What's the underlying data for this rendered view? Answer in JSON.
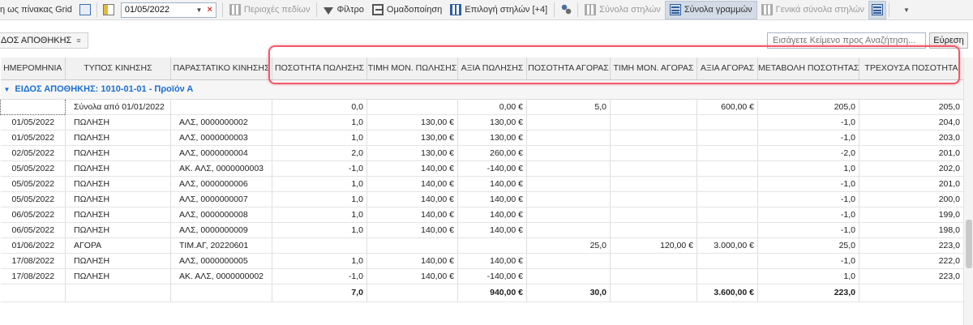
{
  "toolbar": {
    "grid_label": "η ως πίνακας Grid",
    "date_value": "01/05/2022",
    "field_areas": "Περιοχές πεδίων",
    "filter": "Φίλτρο",
    "grouping": "Ομαδοποίηση",
    "column_select": "Επιλογή στηλών [+4]",
    "column_totals": "Σύνολα στηλών",
    "row_totals": "Σύνολα γραμμών",
    "general_totals": "Γενικά σύνολα στηλών"
  },
  "subbar": {
    "tab_label": "ΔΟΣ ΑΠΟΘΗΚΗΣ",
    "search_placeholder": "Εισάγετε Κείμενο προς Αναζήτηση...",
    "search_button": "Εύρεση"
  },
  "columns": [
    "ΗΜΕΡΟΜΗΝΙΑ",
    "ΤΥΠΟΣ ΚΙΝΗΣΗΣ",
    "ΠΑΡΑΣΤΑΤΙΚΟ ΚΙΝΗΣΗΣ",
    "ΠΟΣΟΤΗΤΑ ΠΩΛΗΣΗΣ",
    "ΤΙΜΗ ΜΟΝ. ΠΩΛΗΣΗΣ",
    "ΑΞΙΑ ΠΩΛΗΣΗΣ",
    "ΠΟΣΟΤΗΤΑ ΑΓΟΡΑΣ",
    "ΤΙΜΗ ΜΟΝ. ΑΓΟΡΑΣ",
    "ΑΞΙΑ ΑΓΟΡΑΣ",
    "ΜΕΤΑΒΟΛΗ ΠΟΣΟΤΗΤΑΣ",
    "ΤΡΕΧΟΥΣΑ ΠΟΣΟΤΗΤΑ"
  ],
  "group": {
    "label": "ΕΙΔΟΣ ΑΠΟΘΗΚΗΣ: 1010-01-01 - Προϊόν Α"
  },
  "rows": [
    [
      "",
      "Σύνολα από 01/01/2022",
      "",
      "0,0",
      "",
      "0,00 €",
      "5,0",
      "",
      "600,00 €",
      "205,0",
      "205,0"
    ],
    [
      "01/05/2022",
      "ΠΩΛΗΣΗ",
      "ΑΛΣ, 0000000002",
      "1,0",
      "130,00 €",
      "130,00 €",
      "",
      "",
      "",
      "-1,0",
      "204,0"
    ],
    [
      "01/05/2022",
      "ΠΩΛΗΣΗ",
      "ΑΛΣ, 0000000003",
      "1,0",
      "130,00 €",
      "130,00 €",
      "",
      "",
      "",
      "-1,0",
      "203,0"
    ],
    [
      "02/05/2022",
      "ΠΩΛΗΣΗ",
      "ΑΛΣ, 0000000004",
      "2,0",
      "130,00 €",
      "260,00 €",
      "",
      "",
      "",
      "-2,0",
      "201,0"
    ],
    [
      "05/05/2022",
      "ΠΩΛΗΣΗ",
      "ΑΚ. ΑΛΣ, 0000000003",
      "-1,0",
      "140,00 €",
      "-140,00 €",
      "",
      "",
      "",
      "1,0",
      "202,0"
    ],
    [
      "05/05/2022",
      "ΠΩΛΗΣΗ",
      "ΑΛΣ, 0000000006",
      "1,0",
      "140,00 €",
      "140,00 €",
      "",
      "",
      "",
      "-1,0",
      "201,0"
    ],
    [
      "05/05/2022",
      "ΠΩΛΗΣΗ",
      "ΑΛΣ, 0000000007",
      "1,0",
      "140,00 €",
      "140,00 €",
      "",
      "",
      "",
      "-1,0",
      "200,0"
    ],
    [
      "06/05/2022",
      "ΠΩΛΗΣΗ",
      "ΑΛΣ, 0000000008",
      "1,0",
      "140,00 €",
      "140,00 €",
      "",
      "",
      "",
      "-1,0",
      "199,0"
    ],
    [
      "06/05/2022",
      "ΠΩΛΗΣΗ",
      "ΑΛΣ, 0000000009",
      "1,0",
      "140,00 €",
      "140,00 €",
      "",
      "",
      "",
      "-1,0",
      "198,0"
    ],
    [
      "01/06/2022",
      "ΑΓΟΡΑ",
      "ΤΙΜ.ΑΓ, 20220601",
      "",
      "",
      "",
      "25,0",
      "120,00 €",
      "3.000,00 €",
      "25,0",
      "223,0"
    ],
    [
      "17/08/2022",
      "ΠΩΛΗΣΗ",
      "ΑΛΣ, 0000000005",
      "1,0",
      "140,00 €",
      "140,00 €",
      "",
      "",
      "",
      "-1,0",
      "222,0"
    ],
    [
      "17/08/2022",
      "ΠΩΛΗΣΗ",
      "ΑΚ. ΑΛΣ, 0000000002",
      "-1,0",
      "140,00 €",
      "-140,00 €",
      "",
      "",
      "",
      "1,0",
      "223,0"
    ]
  ],
  "totals": [
    "",
    "",
    "",
    "7,0",
    "",
    "940,00 €",
    "30,0",
    "",
    "3.600,00 €",
    "223,0",
    ""
  ],
  "colors": {
    "group_text": "#1a6fd1",
    "highlight_border": "#f05a6a"
  }
}
